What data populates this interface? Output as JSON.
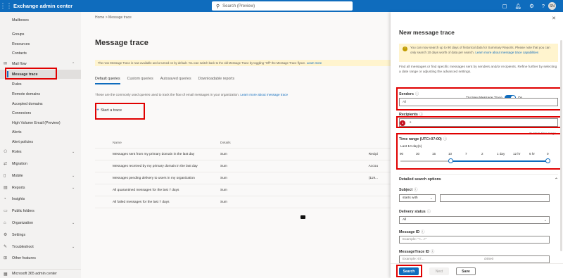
{
  "topbar": {
    "app_title": "Exchange admin center",
    "search_placeholder": "Search (Preview)",
    "avatar_initials": "SN"
  },
  "sidebar": {
    "items": [
      {
        "label": "Mailboxes",
        "icon": "none"
      },
      {
        "label": "Groups",
        "icon": "none"
      },
      {
        "label": "Resources",
        "icon": "none"
      },
      {
        "label": "Contacts",
        "icon": "none"
      },
      {
        "label": "Mail flow",
        "icon": "mail-flow-icon"
      },
      {
        "label": "Message trace",
        "icon": "none"
      },
      {
        "label": "Rules",
        "icon": "none"
      },
      {
        "label": "Remote domains",
        "icon": "none"
      },
      {
        "label": "Accepted domains",
        "icon": "none"
      },
      {
        "label": "Connectors",
        "icon": "none"
      },
      {
        "label": "High Volume Email (Preview)",
        "icon": "none"
      },
      {
        "label": "Alerts",
        "icon": "none"
      },
      {
        "label": "Alert policies",
        "icon": "none"
      },
      {
        "label": "Roles",
        "icon": "roles-icon"
      },
      {
        "label": "Migration",
        "icon": "migration-icon"
      },
      {
        "label": "Mobile",
        "icon": "mobile-icon"
      },
      {
        "label": "Reports",
        "icon": "reports-icon"
      },
      {
        "label": "Insights",
        "icon": "insights-icon"
      },
      {
        "label": "Public folders",
        "icon": "public-folders-icon"
      },
      {
        "label": "Organization",
        "icon": "organization-icon"
      },
      {
        "label": "Settings",
        "icon": "settings-icon"
      },
      {
        "label": "Troubleshoot",
        "icon": "troubleshoot-icon"
      },
      {
        "label": "Other features",
        "icon": "other-features-icon"
      },
      {
        "label": "Microsoft 365 admin center",
        "icon": "m365-icon"
      }
    ]
  },
  "main": {
    "breadcrumb_home": "Home",
    "breadcrumb_sep": ">",
    "breadcrumb_current": "Message trace",
    "title": "Message trace",
    "banner_text": "The new Message Trace is now available and a turned on by default. You can switch back to the old Message Trace by toggling \"Off\" the Message Trace flyout.",
    "banner_link": "Learn more",
    "tabs": [
      "Default queries",
      "Custom queries",
      "Autosaved queries",
      "Downloadable reports"
    ],
    "description": "These are the commonly used queries used to track the flow of email messages in your organization.",
    "description_link": "Learn more about message trace",
    "start_trace": "Start a trace",
    "table": {
      "headers": [
        "Name",
        "Details",
        ""
      ],
      "rows": [
        [
          "Messages sent from my primary domain in the last day",
          "Sum",
          "Recipi"
        ],
        [
          "Messages received by my primary domain in the last day",
          "Sum",
          "Accou"
        ],
        [
          "Messages pending delivery to users in my organization",
          "Sum",
          "(119..."
        ],
        [
          "All quarantined messages for the last 7 days",
          "Sum",
          ""
        ],
        [
          "All failed messages for the last 7 days",
          "Sum",
          ""
        ]
      ]
    }
  },
  "flyout": {
    "title": "New message trace",
    "warning": "You can now search up to 90 days of historical data for Summary Reports. Please note that you can only search 10 days worth of data per search.",
    "warning_link": "Learn more about message trace capabilities",
    "description": "Find all messages or find specific messages sent by senders and/or recipients. Refine further by selecting a date range or adjusting the advanced settings.",
    "toggle_label": "Try New Message Trace",
    "toggle_state": "On",
    "senders_label": "Senders",
    "senders_value": "All",
    "recipients_label": "Recipients",
    "recipients_value": "s",
    "recipients_badge": "1",
    "hint": "Custom time range",
    "time_range_label": "Time range (UTC+07:00)",
    "time_range_value": "Last 10 day(s)",
    "ticks": [
      "90",
      "30",
      "15",
      "10",
      "7",
      "2",
      "1 day",
      "12 hr",
      "6 hr",
      "0"
    ],
    "detailed_label": "Detailed search options",
    "subject_label": "Subject",
    "subject_operator": "starts with",
    "subject_value": "",
    "delivery_status_label": "Delivery status",
    "delivery_status_value": "All",
    "message_id_label": "Message ID",
    "message_id_placeholder": "Example: \"<...>\"",
    "messagetrace_id_label": "MessageTrace ID",
    "messagetrace_id_placeholder": "Example: 67...",
    "messagetrace_id_suffix": "d46e0",
    "buttons": {
      "search": "Search",
      "next": "Next",
      "save": "Save"
    }
  },
  "colors": {
    "accent": "#0f6cbd",
    "highlight": "#e00000",
    "banner": "#fff4ce"
  }
}
